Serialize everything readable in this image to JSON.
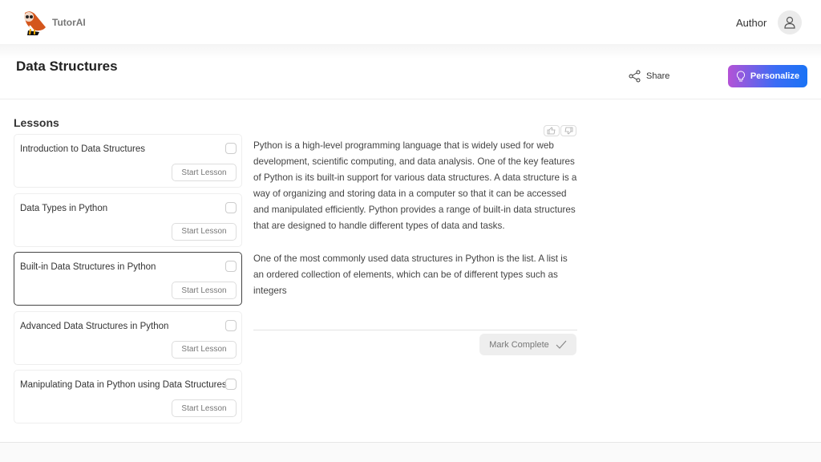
{
  "header": {
    "brand": "TutorAI",
    "user_label": "Author"
  },
  "page": {
    "title": "Data Structures",
    "share_label": "Share",
    "personalize_label": "Personalize"
  },
  "lessons": {
    "title": "Lessons",
    "items": [
      {
        "name": "Introduction to Data Structures",
        "button": "Start Lesson",
        "completed": false,
        "active": false
      },
      {
        "name": "Data Types in Python",
        "button": "Start Lesson",
        "completed": false,
        "active": false
      },
      {
        "name": "Built-in Data Structures in Python",
        "button": "Start Lesson",
        "completed": false,
        "active": true
      },
      {
        "name": "Advanced Data Structures in Python",
        "button": "Start Lesson",
        "completed": false,
        "active": false
      },
      {
        "name": "Manipulating Data in Python using Data Structures",
        "button": "Start Lesson",
        "completed": false,
        "active": false
      }
    ]
  },
  "content": {
    "paragraphs": [
      "Python is a high-level programming language that is widely used for web development, scientific computing, and data analysis. One of the key features of Python is its built-in support for various data structures. A data structure is a way of organizing and storing data in a computer so that it can be accessed and manipulated efficiently. Python provides a range of built-in data structures that are designed to handle different types of data and tasks.",
      "One of the most commonly used data structures in Python is the list. A list is an ordered collection of elements, which can be of different types such as integers"
    ],
    "mark_complete_label": "Mark Complete"
  },
  "colors": {
    "accent_start": "#b452d6",
    "accent_end": "#1a73f5"
  }
}
